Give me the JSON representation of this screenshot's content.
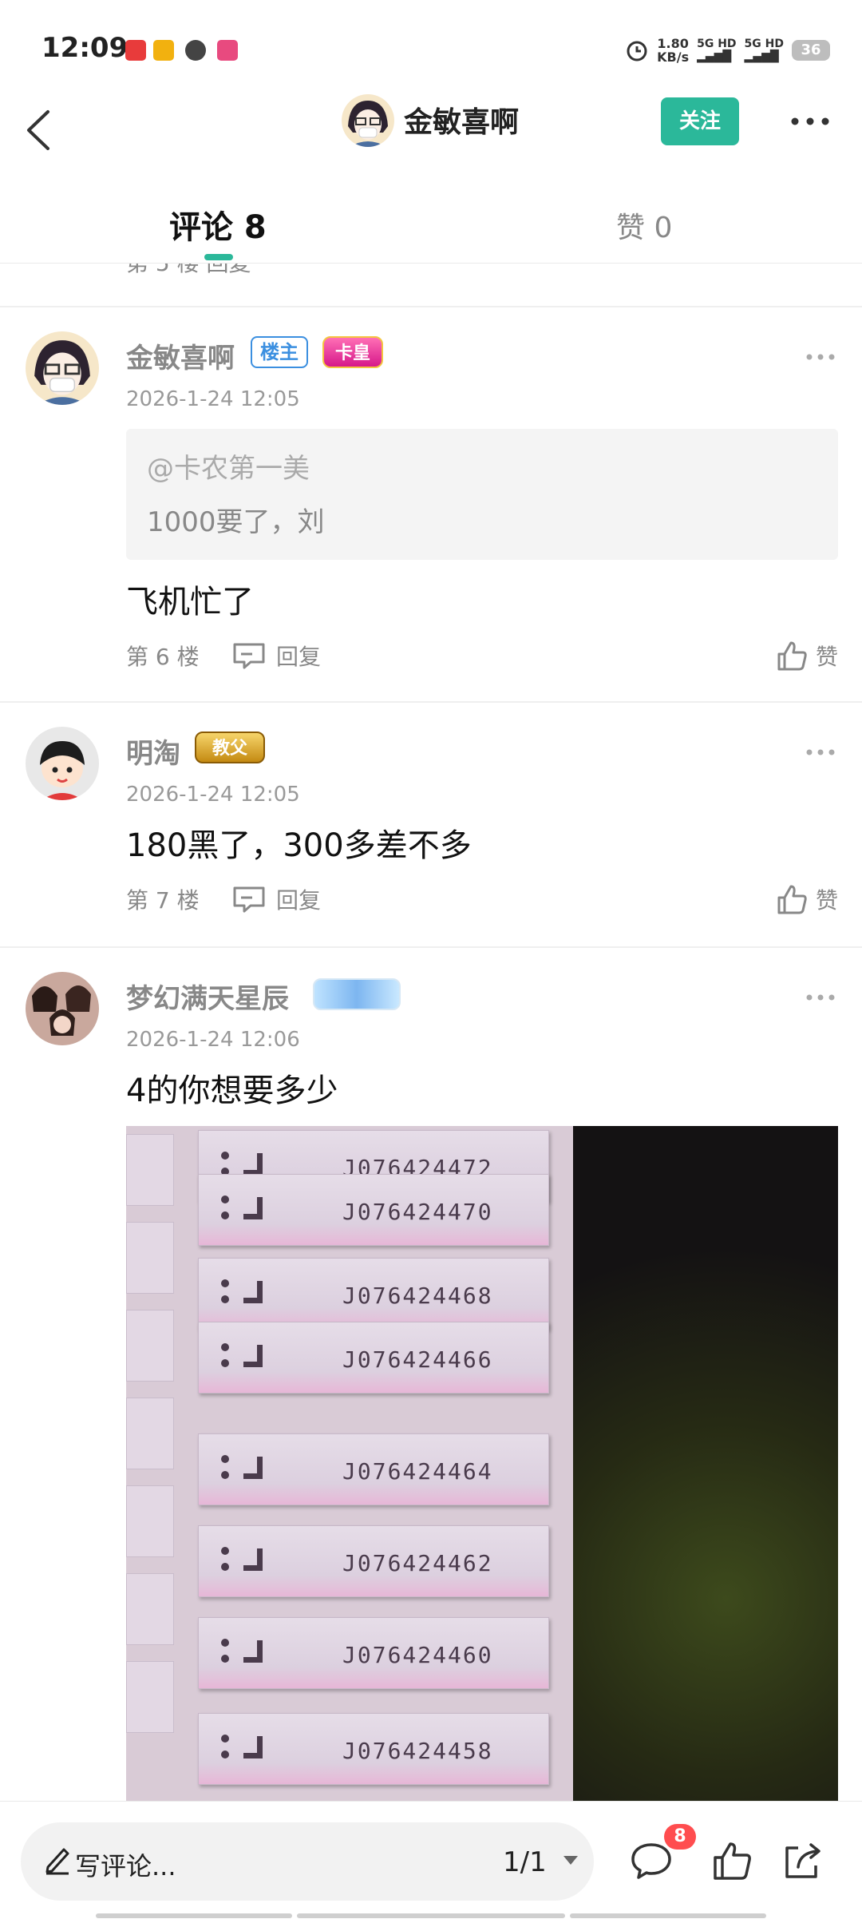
{
  "status_bar": {
    "time": "12:09",
    "speed_value": "1.80",
    "speed_unit": "KB/s",
    "signal1": "5G HD",
    "signal2": "5G HD",
    "battery": "36"
  },
  "header": {
    "username": "金敏喜啊",
    "follow_label": "关注"
  },
  "tabs": {
    "comments_label": "评论 8",
    "likes_label": "赞 0"
  },
  "peek": {
    "text": "第 5 楼   回复"
  },
  "comments": [
    {
      "name": "金敏喜啊",
      "owner_badge": "楼主",
      "level_badge": "卡皇",
      "time": "2026-1-24 12:05",
      "quote_mention": "@卡农第一美",
      "quote_text": "1000要了，刘",
      "text": "飞机忙了",
      "floor": "第 6 楼",
      "reply_label": "回复",
      "like_label": "赞"
    },
    {
      "name": "明淘",
      "level_badge": "教父",
      "time": "2026-1-24 12:05",
      "text": "180黑了，300多差不多",
      "floor": "第 7 楼",
      "reply_label": "回复",
      "like_label": "赞"
    },
    {
      "name": "梦幻满天星辰",
      "time": "2026-1-24 12:06",
      "text": "4的你想要多少",
      "photo_codes": [
        "J076424472",
        "J076424470",
        "J076424468",
        "J076424466",
        "J076424464",
        "J076424462",
        "J076424460",
        "J076424458"
      ]
    }
  ],
  "bottom_bar": {
    "input_label": "写评论...",
    "page_indicator": "1/1",
    "comment_count": "8"
  },
  "colors": {
    "accent": "#2bb89a",
    "owner_badge": "#3b8fe0",
    "count_badge": "#ff4d4f"
  }
}
